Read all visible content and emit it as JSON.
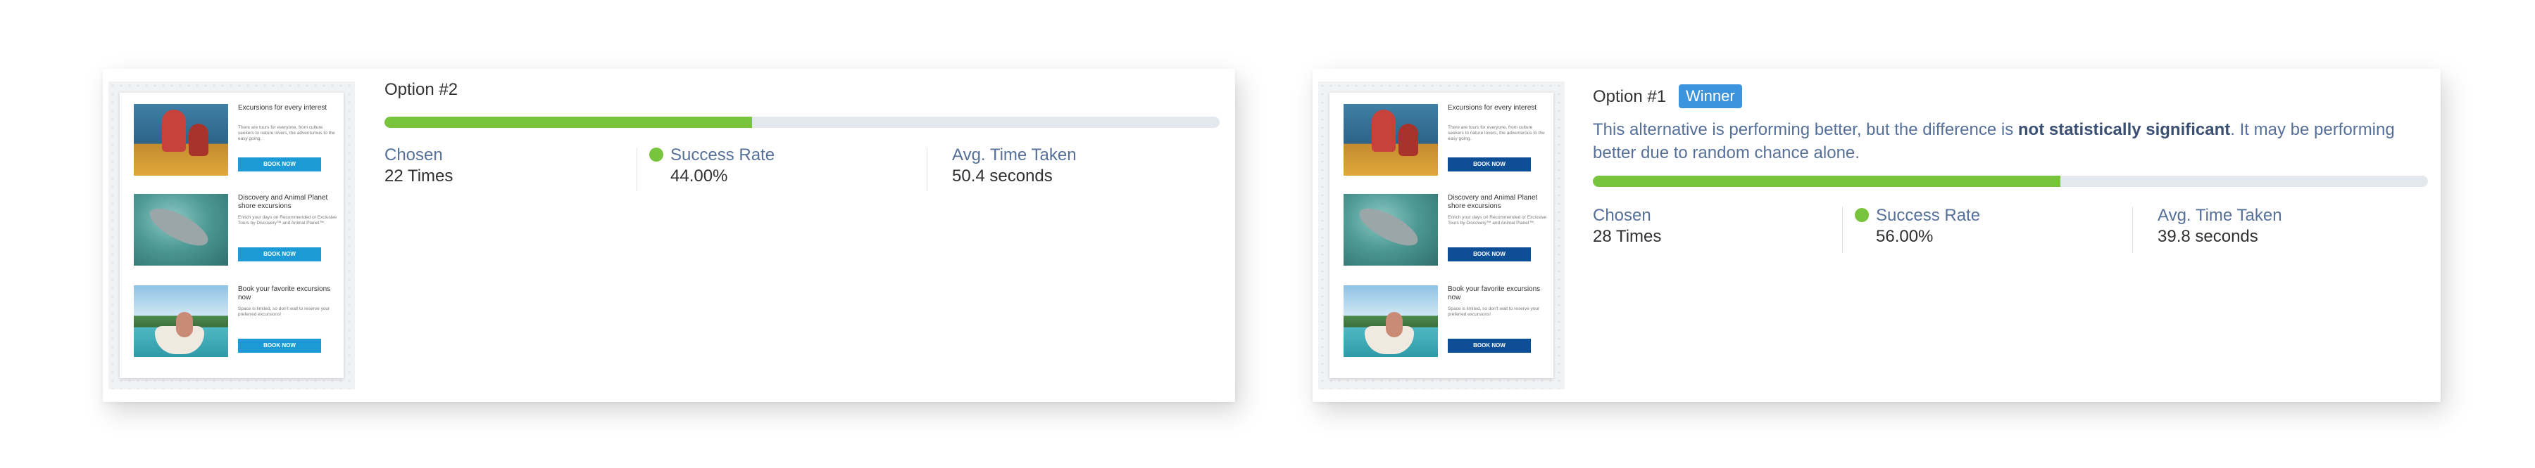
{
  "email_preview": {
    "items": [
      {
        "title": "Excursions for every interest",
        "body": "There are tours for everyone, from culture seekers to nature lovers, the adventurous to the easy going.",
        "button": "BOOK NOW",
        "image": "kayak-photo"
      },
      {
        "title": "Discovery and Animal Planet shore excursions",
        "body": "Enrich your days on Recommended or Exclusive Tours by Discovery™ and Animal Planet™.",
        "button": "BOOK NOW",
        "image": "dolphin-photo"
      },
      {
        "title": "Book your favorite excursions now",
        "body": "Space is limited, so don't wait to reserve your preferred excursions!",
        "button": "BOOK NOW",
        "image": "beach-boat-photo"
      }
    ]
  },
  "options": [
    {
      "title": "Option #2",
      "progress_fraction": 0.44,
      "chosen_label": "Chosen",
      "chosen_value": "22 Times",
      "success_label": "Success Rate",
      "success_value": "44.00%",
      "time_label": "Avg. Time Taken",
      "time_value": "50.4 seconds"
    },
    {
      "title": "Option #1",
      "badge": "Winner",
      "note_start": "This alternative is performing better, but the difference is ",
      "note_bold": "not statistically significant",
      "note_end": ". It may be performing better due to random chance alone.",
      "progress_fraction": 0.56,
      "chosen_label": "Chosen",
      "chosen_value": "28 Times",
      "success_label": "Success Rate",
      "success_value": "56.00%",
      "time_label": "Avg. Time Taken",
      "time_value": "39.8 seconds"
    }
  ],
  "colors": {
    "progress_fill": "#78c43c",
    "progress_track": "#e3e8ef",
    "badge": "#3d94de",
    "label": "#56709a",
    "button_light": "#1b9ad6",
    "button_dark": "#0d4e97"
  }
}
